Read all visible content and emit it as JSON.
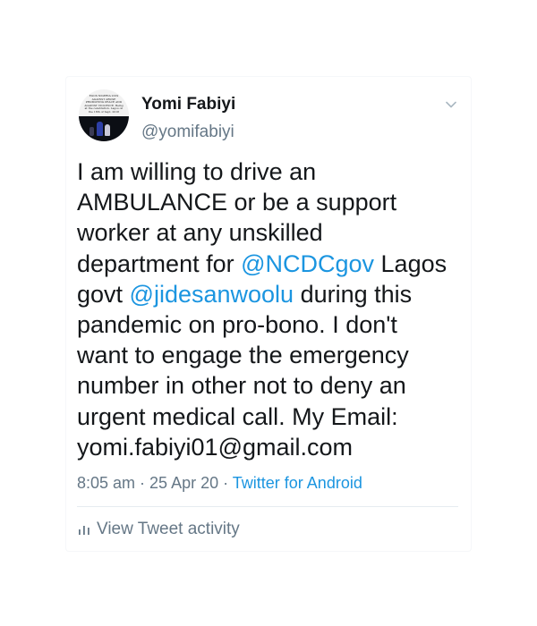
{
  "author": {
    "display_name": "Yomi Fabiyi",
    "handle": "@yomifabiyi",
    "avatar_caption": "EGOS NIGERIA 2019 AGAINST ABUSE PROMOTING PEACE AND AGAINST VIOLENCE. Being at the celebration. Lagos on the 18th of Sept. 2018"
  },
  "menu_icon": "chevron-down-icon",
  "tweet": {
    "lines": [
      [
        {
          "text": "I am willing to drive an"
        }
      ],
      [
        {
          "text": "AMBULANCE or be a support"
        }
      ],
      [
        {
          "text": "worker at any unskilled"
        }
      ],
      [
        {
          "text": "department for "
        },
        {
          "text": "@NCDCgov",
          "mention": true
        },
        {
          "text": " Lagos"
        }
      ],
      [
        {
          "text": "govt "
        },
        {
          "text": "@jidesanwoolu",
          "mention": true
        },
        {
          "text": " during this"
        }
      ],
      [
        {
          "text": "pandemic on pro-bono. I don't"
        }
      ],
      [
        {
          "text": "want to engage the emergency"
        }
      ],
      [
        {
          "text": "number in other not to deny an"
        }
      ],
      [
        {
          "text": "urgent medical call. My Email:"
        }
      ],
      [
        {
          "text": "yomi.fabiyi01@gmail.com"
        }
      ]
    ]
  },
  "meta": {
    "time": "8:05 am",
    "separator": " · ",
    "date": "25 Apr 20",
    "source": "Twitter for Android"
  },
  "activity": {
    "icon": "bar-chart-icon",
    "label": "View Tweet activity"
  },
  "colors": {
    "link": "#1b95e0",
    "secondary_text": "#657786",
    "primary_text": "#14171a"
  }
}
